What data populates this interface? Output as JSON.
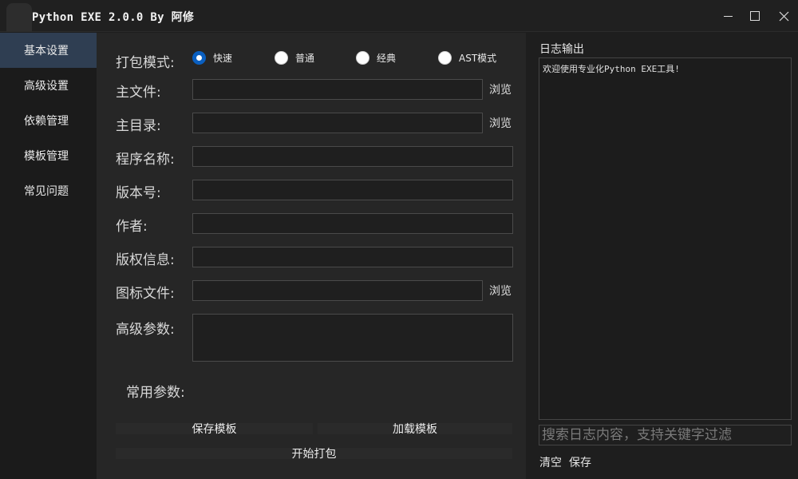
{
  "window": {
    "title": "Python EXE 2.0.0 By 阿修",
    "controls": [
      "minimize-icon",
      "maximize-icon",
      "close-icon"
    ]
  },
  "sidebar": {
    "items": [
      {
        "label": "基本设置",
        "active": true
      },
      {
        "label": "高级设置",
        "active": false
      },
      {
        "label": "依赖管理",
        "active": false
      },
      {
        "label": "模板管理",
        "active": false
      },
      {
        "label": "常见问题",
        "active": false
      }
    ]
  },
  "form": {
    "pack_mode_label": "打包模式:",
    "pack_modes": [
      {
        "label": "快速",
        "checked": true
      },
      {
        "label": "普通",
        "checked": false
      },
      {
        "label": "经典",
        "checked": false
      },
      {
        "label": "AST模式",
        "checked": false
      }
    ],
    "main_file_label": "主文件:",
    "main_file_value": "",
    "main_dir_label": "主目录:",
    "main_dir_value": "",
    "program_name_label": "程序名称:",
    "program_name_value": "",
    "version_label": "版本号:",
    "version_value": "",
    "author_label": "作者:",
    "author_value": "",
    "copyright_label": "版权信息:",
    "copyright_value": "",
    "icon_file_label": "图标文件:",
    "icon_file_value": "",
    "advanced_params_label": "高级参数:",
    "advanced_params_value": "",
    "common_params_label": "常用参数:",
    "browse_label": "浏览",
    "save_template_label": "保存模板",
    "load_template_label": "加载模板",
    "start_pack_label": "开始打包"
  },
  "log": {
    "title": "日志输出",
    "content": "欢迎使用专业化Python EXE工具!",
    "search_placeholder": "搜索日志内容，支持关键字过滤",
    "clear_label": "清空",
    "save_label": "保存"
  },
  "colors": {
    "window_bg": "#1e1e1e",
    "panel_bg": "#262626",
    "sidebar_active": "#2f3e52",
    "radio_accent": "#0a5fc0"
  }
}
